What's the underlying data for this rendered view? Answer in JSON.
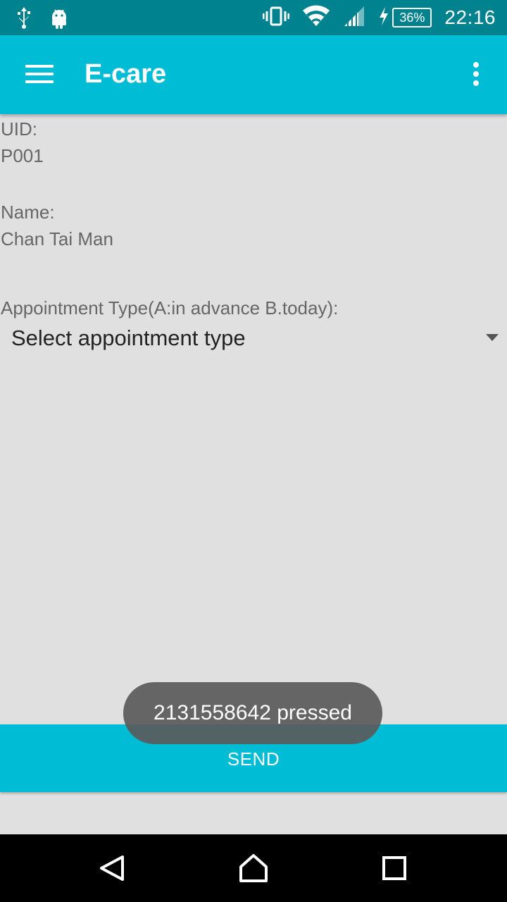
{
  "status_bar": {
    "icons_left": [
      "usb-icon",
      "android-icon"
    ],
    "icons_right": [
      "vibrate-icon",
      "wifi-icon",
      "signal-icon",
      "charging-icon"
    ],
    "battery": "36%",
    "time": "22:16"
  },
  "toolbar": {
    "title": "E-care",
    "menu_icon": "hamburger-menu-icon",
    "overflow_icon": "more-vert-icon",
    "color": "#00bcd4"
  },
  "form": {
    "uid_label": "UID:",
    "uid_value": "P001",
    "name_label": "Name:",
    "name_value": "Chan Tai Man",
    "appointment_label": "Appointment Type(A:in advance B.today):",
    "appointment_select": "Select appointment type"
  },
  "send_button": {
    "label": "SEND"
  },
  "toast": {
    "message": "2131558642 pressed"
  },
  "nav_bar": {
    "back_icon": "back-triangle-icon",
    "home_icon": "home-icon",
    "recents_icon": "recents-square-icon"
  }
}
